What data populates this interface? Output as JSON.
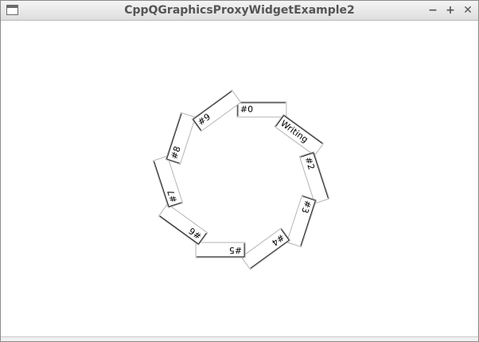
{
  "window": {
    "title": "CppQGraphicsProxyWidgetExample2",
    "buttons": {
      "minimize": "−",
      "maximize": "+",
      "close": "✕"
    }
  },
  "scene": {
    "line_edits": [
      {
        "name": "line-edit-0",
        "value": "#0",
        "focused": true
      },
      {
        "name": "line-edit-1",
        "value": "Writing"
      },
      {
        "name": "line-edit-2",
        "value": "#2"
      },
      {
        "name": "line-edit-3",
        "value": "#3"
      },
      {
        "name": "line-edit-4",
        "value": "#4"
      },
      {
        "name": "line-edit-5",
        "value": "#5"
      },
      {
        "name": "line-edit-6",
        "value": "#6"
      },
      {
        "name": "line-edit-7",
        "value": "#7"
      },
      {
        "name": "line-edit-8",
        "value": "#8"
      },
      {
        "name": "line-edit-9",
        "value": "#9"
      }
    ]
  }
}
